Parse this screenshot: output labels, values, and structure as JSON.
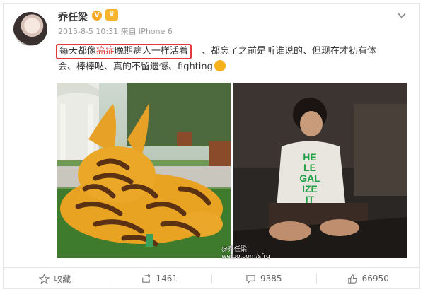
{
  "post": {
    "author": "乔任梁",
    "verified_badge": "V",
    "member_badge": "♛",
    "timestamp": "2015-8-5 10:31",
    "source": "来自 iPhone 6",
    "text_highlighted_before": "每天都像",
    "text_highlighted_red": "癌症",
    "text_highlighted_after": "晚期病人一样活着",
    "text_rest_line1": "、都忘了之前是听谁说的、但现在才初有体",
    "text_rest_line2": "会、棒棒哒、真的不留遗憾、fighting",
    "emoji": "sun-emoji",
    "watermark_line1": "@乔任梁",
    "watermark_line2": "weibo.com/sfrq"
  },
  "shirt_text": [
    "HE",
    "LE",
    "GAL",
    "IZE",
    "IT"
  ],
  "actions": {
    "favorite_label": "收藏",
    "repost_count": "1461",
    "comment_count": "9385",
    "like_count": "66950"
  },
  "colors": {
    "highlight_border": "#e23a3a",
    "badge": "#f5a623",
    "text_muted": "#9a9a9a"
  }
}
